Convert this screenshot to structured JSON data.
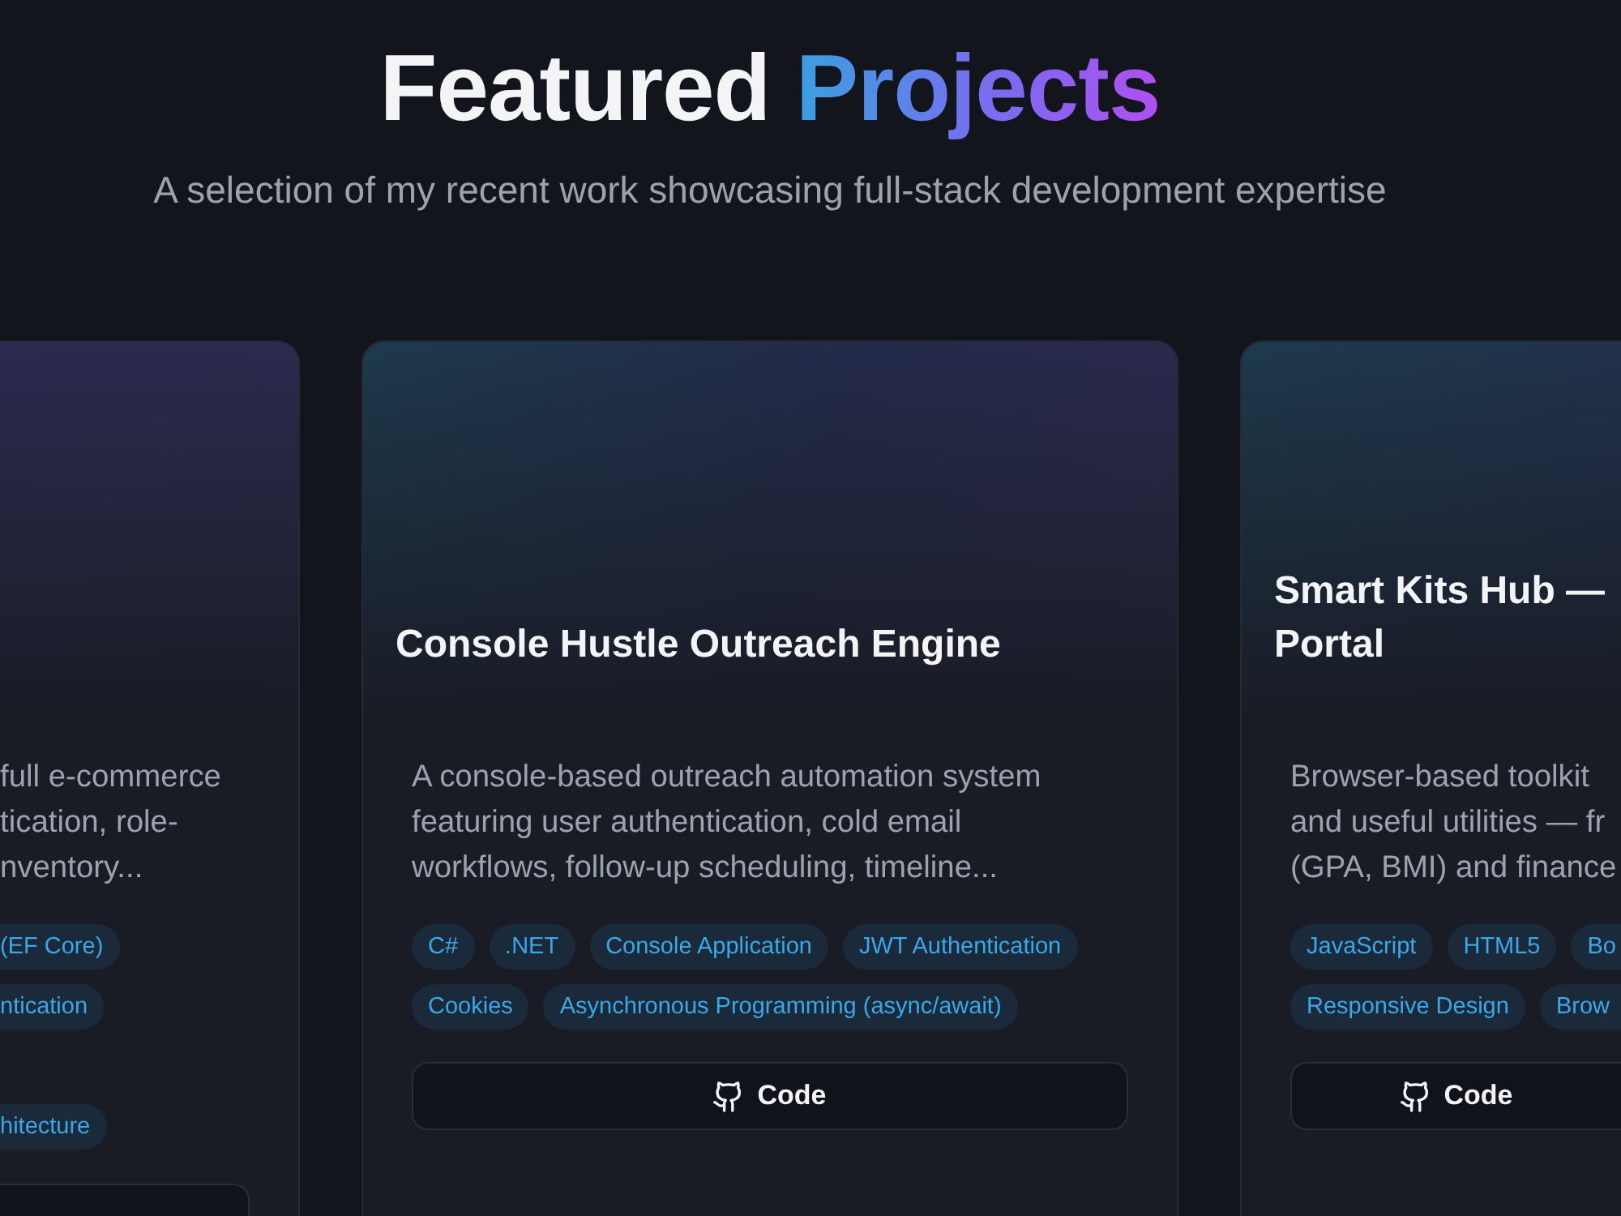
{
  "header": {
    "title": "Featured",
    "title_highlight": "Projects",
    "subtitle": "A selection of my recent work showcasing full-stack development expertise"
  },
  "projects": [
    {
      "kind": "cut_left",
      "description_lines": [
        "full e-commerce",
        "tication, role-",
        "nventory..."
      ],
      "tag_rows": [
        [
          "(EF Core)"
        ],
        [
          "ntication"
        ],
        [
          "hitecture"
        ]
      ],
      "button": {
        "visible": true
      }
    },
    {
      "kind": "full",
      "title_lines": [
        "Console Hustle Outreach Engine"
      ],
      "description_lines": [
        "A console-based outreach automation system",
        "featuring user authentication, cold email",
        "workflows, follow-up scheduling, timeline..."
      ],
      "tag_rows": [
        [
          "C#",
          ".NET",
          "Console Application",
          "JWT Authentication"
        ],
        [
          "Cookies",
          "Asynchronous Programming (async/await)"
        ]
      ],
      "button": {
        "visible": true,
        "label": "Code"
      }
    },
    {
      "kind": "cut_right",
      "title_lines": [
        "Smart Kits Hub —",
        "Portal"
      ],
      "description_lines": [
        "Browser-based toolkit",
        "and useful utilities — fr",
        "(GPA, BMI) and finance"
      ],
      "tag_rows": [
        [
          "JavaScript",
          "HTML5",
          "Bo"
        ],
        [
          "Responsive Design",
          "Brow"
        ]
      ],
      "button": {
        "visible": true,
        "label": "Code"
      }
    }
  ]
}
